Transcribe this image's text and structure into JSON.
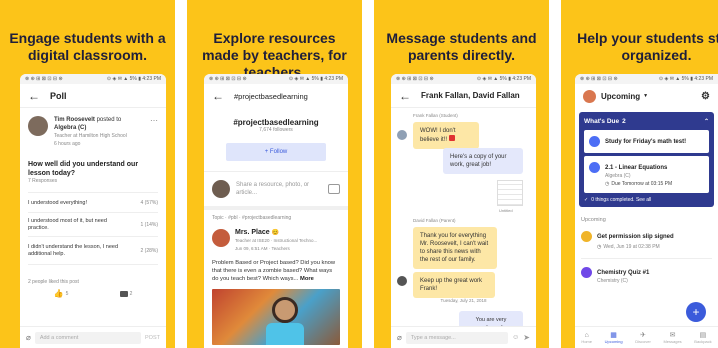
{
  "panels": [
    {
      "caption": "Engage students with a digital classroom.",
      "status_left": "⊗ ⊕ ⊞ ⊠ ⊡ ⊟ ⊛",
      "status_right": "⊙ ◈ ✉ ▲ 5% ▮ 4:23 PM",
      "title": "Poll",
      "author": "Tim Roosevelt",
      "posted_to": "posted to",
      "class": "Algebra (C)",
      "teacher_at": "Teacher at Hamilton High School",
      "time": "6 hours ago",
      "question": "How well did you understand our lesson today?",
      "responses": "7 Responses",
      "options": [
        {
          "label": "I understood everything!",
          "value": "4 (57%)"
        },
        {
          "label": "I understood most of it, but need practice.",
          "value": "1 (14%)"
        },
        {
          "label": "I didn't understand the lesson, I need additional help.",
          "value": "2 (28%)"
        }
      ],
      "liked": "2 people liked this post",
      "likes": "5",
      "comments": "2",
      "comment_placeholder": "Add a comment",
      "post": "POST"
    },
    {
      "caption": "Explore resources made by teachers, for teachers.",
      "status_left": "⊗ ⊕ ⊞ ⊠ ⊡ ⊟ ⊛",
      "status_right": "⊙ ◈ ✉ ▲ 5% ▮ 4:23 PM",
      "title": "#projectbasedlearning",
      "hashtag": "#projectbasedlearning",
      "followers": "7,674 followers",
      "follow": "+ Follow",
      "share_placeholder": "Share a resource, photo, or article...",
      "topic": "Topic · #pbl · #projectbasedlearning",
      "author": "Mrs. Place",
      "author_meta": "Teacher at ISE20 · Instructional Techno...",
      "date": "Jun 09, 6:51 AM · Teachers",
      "post_text": "Problem Based or Project based? Did you know that there is even a zombie based? What ways do you teach best? Which ways...",
      "more": "More"
    },
    {
      "caption": "Message students and parents directly.",
      "status_left": "⊗ ⊕ ⊞ ⊠ ⊡ ⊟ ⊛",
      "status_right": "⊙ ◈ ✉ ▲ 5% ▮ 4:23 PM",
      "title": "Frank Fallan, David Fallan",
      "sender1": "Frank Fallan (Student)",
      "msg1": "WOW! I don't believe it!!",
      "msg2": "Here's a copy of your work, great job!",
      "file": "Untitled",
      "sender2": "David Fallan (Parent)",
      "msg3": "Thank you for everything Mr. Roosevelt, I can't wait to share this news with the rest of our family.",
      "msg4": "Keep up the great work Frank!",
      "date": "Tuesday, July 21, 2018",
      "msg5": "You are very welcome!",
      "placeholder": "Type a message..."
    },
    {
      "caption": "Help your students stay organized.",
      "status_left": "⊗ ⊕ ⊞ ⊠ ⊡ ⊟ ⊛",
      "status_right": "⊙ ◈ ✉ ▲ 5% ▮ 4:23 PM",
      "title": "Upcoming",
      "whats_due": "What's Due",
      "due_count": "2",
      "task1": "Study for Friday's math test!",
      "task2": "2.1 - Linear Equations",
      "task2_class": "Algebra (C)",
      "task2_due": "Due Tomorrow at 03:15 PM",
      "completed": "0 things completed. See all",
      "upcoming": "Upcoming",
      "item1": "Get permission slip signed",
      "item1_date": "Wed, Jun 19 at 02:38 PM",
      "item2": "Chemistry Quiz #1",
      "item2_class": "Chemistry (C)",
      "nav": [
        "Home",
        "Upcoming",
        "Discover",
        "Messages",
        "Backpack"
      ],
      "fab": "+"
    }
  ],
  "colors": {
    "brand_yellow": "#fcc419",
    "navy": "#2f3a8f",
    "accent_blue": "#3b5bdb",
    "text_dark": "#1f1f3a"
  }
}
